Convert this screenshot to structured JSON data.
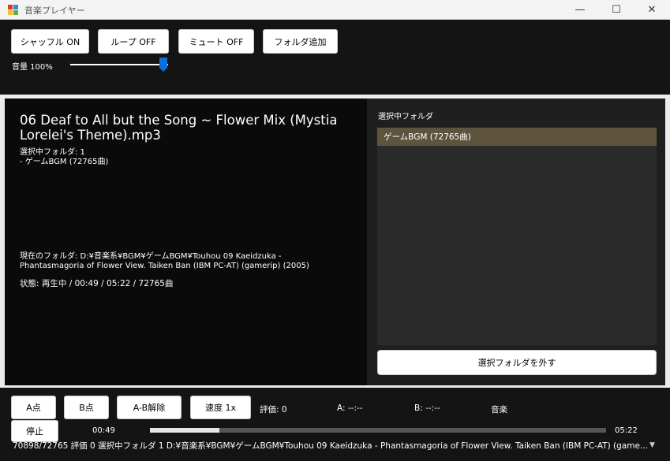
{
  "window": {
    "title": "音楽プレイヤー",
    "minimize_glyph": "—",
    "maximize_glyph": "☐",
    "close_glyph": "✕"
  },
  "toolbar": {
    "shuffle_label": "シャッフル ON",
    "loop_label": "ループ OFF",
    "mute_label": "ミュート OFF",
    "add_folder_label": "フォルダ追加",
    "volume_label": "音量 100%",
    "volume_value": 100
  },
  "now_playing": {
    "title": "06 Deaf to All but the Song ~ Flower Mix (Mystia Lorelei's Theme).mp3",
    "selected_count_line": "選択中フォルダ: 1",
    "selected_folder_line": "- ゲームBGM (72765曲)",
    "current_folder_line1": "現在のフォルダ: D:¥音楽系¥BGM¥ゲームBGM¥Touhou 09 Kaeidzuka -",
    "current_folder_line2": "Phantasmagoria of Flower View. Taiken Ban (IBM PC-AT) (gamerip) (2005)",
    "status_line": "状態: 再生中 / 00:49 / 05:22 / 72765曲"
  },
  "folder_panel": {
    "heading": "選択中フォルダ",
    "items": [
      {
        "label": "ゲームBGM (72765曲)"
      }
    ],
    "remove_button_label": "選択フォルダを外す"
  },
  "controls": {
    "a_point_label": "A点",
    "b_point_label": "B点",
    "ab_clear_label": "A-B解除",
    "speed_label": "速度 1x",
    "rating_label": "評価: 0",
    "a_value": "A: --:--",
    "b_value": "B: --:--",
    "music_label": "音楽",
    "stop_label": "停止",
    "elapsed": "00:49",
    "total": "05:22",
    "progress_fraction": 0.152
  },
  "statusbar": {
    "text": "70898/72765  評価 0  選択中フォルダ 1  D:¥音楽系¥BGM¥ゲームBGM¥Touhou 09 Kaeidzuka - Phantasmagoria of Flower View. Taiken Ban (IBM PC-AT) (game..."
  },
  "colors": {
    "accent": "#0a6fd9",
    "selected_item": "#5e543d",
    "background": "#141414"
  }
}
